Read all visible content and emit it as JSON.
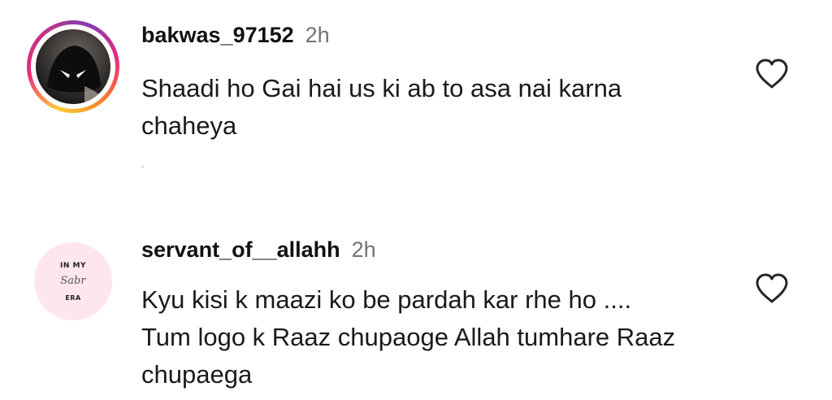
{
  "comments": [
    {
      "username": "bakwas_97152",
      "time": "2h",
      "text": "Shaadi ho Gai hai us ki ab to asa nai karna chaheya",
      "avatar": {
        "style": "story-ring-photo"
      },
      "like_icon": "heart-outline-icon"
    },
    {
      "username": "servant_of__allahh",
      "time": "2h",
      "text": "Kyu kisi k maazi ko be pardah kar rhe ho .... Tum logo k Raaz chupaoge Allah tumhare Raaz chupaega",
      "avatar": {
        "style": "pink-circle-text",
        "line1": "IN MY",
        "line2": "Sabr",
        "line3": "ERA"
      },
      "like_icon": "heart-outline-icon"
    }
  ],
  "colors": {
    "username": "#111111",
    "time": "#737373",
    "ring_gradient": [
      "#f9ce34",
      "#ee2a7b",
      "#833ab4"
    ],
    "avatar2_bg": "#fde6ef"
  }
}
